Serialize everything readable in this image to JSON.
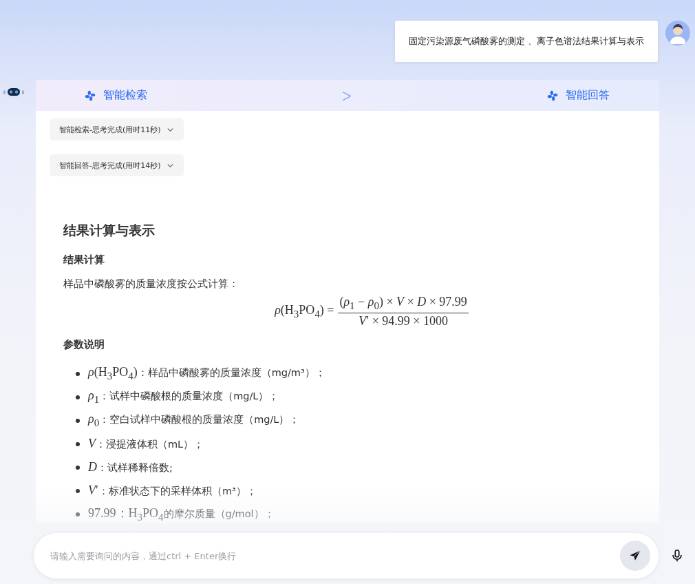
{
  "user_message": {
    "text": "固定污染源废气磷酸雾的测定 、离子色谱法结果计算与表示"
  },
  "steps": [
    {
      "label": "智能检索"
    },
    {
      "label": "智能回答"
    }
  ],
  "step_separator": ">",
  "thinking": [
    {
      "label": "智能检索-思考完成(用时11秒)",
      "expanded": false
    },
    {
      "label": "智能回答-思考完成(用时14秒)",
      "expanded": false
    }
  ],
  "answer": {
    "title": "结果计算与表示",
    "section_1": "结果计算",
    "intro": "样品中磷酸雾的质量浓度按公式计算：",
    "formula": {
      "lhs": "*ρ*(H$_{3}$PO$_{4}$) =",
      "numerator": "(*ρ*$_{1}$ − *ρ*$_{0}$) × *V* × *D* × 97.99",
      "denominator": "*V*′ × 94.99 × 1000"
    },
    "section_2": "参数说明",
    "parameters": [
      {
        "symbol": "*ρ*(H$_{3}$PO$_{4}$)",
        "text": "：样品中磷酸雾的质量浓度（mg/m³）；"
      },
      {
        "symbol": "*ρ*$_{1}$",
        "text": "：试样中磷酸根的质量浓度（mg/L）；"
      },
      {
        "symbol": "*ρ*$_{0}$",
        "text": "：空白试样中磷酸根的质量浓度（mg/L）；"
      },
      {
        "symbol": "*V*",
        "text": "：浸提液体积（mL）；"
      },
      {
        "symbol": "*D*",
        "text": "：试样稀释倍数;"
      },
      {
        "symbol": "*V*′",
        "text": "：标准状态下的采样体积（m³）；"
      },
      {
        "symbol": "97.99：H$_{3}$PO$_{4}$",
        "text": "的摩尔质量（g/mol）；"
      }
    ]
  },
  "input": {
    "placeholder": "请输入需要询问的内容，通过ctrl + Enter换行"
  }
}
